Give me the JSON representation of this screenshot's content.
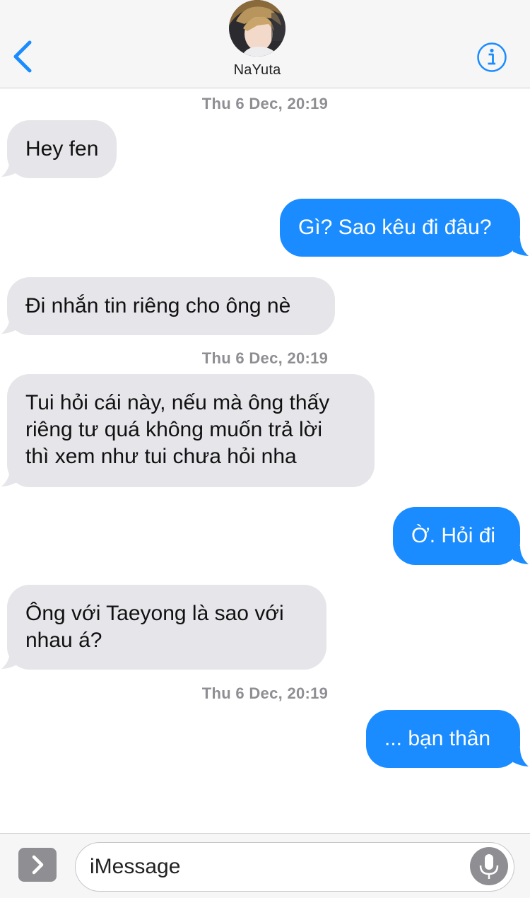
{
  "header": {
    "contact_name": "NaYuta",
    "back_icon": "chevron-left-icon",
    "info_icon": "info-circle-icon",
    "accent_color": "#1a8cff"
  },
  "conversation": {
    "timestamps": [
      "Thu 6 Dec, 20:19",
      "Thu 6 Dec, 20:19",
      "Thu 6 Dec, 20:19"
    ],
    "messages": [
      {
        "sender": "contact",
        "text": "Hey fen"
      },
      {
        "sender": "me",
        "text": "Gì? Sao kêu đi đâu?"
      },
      {
        "sender": "contact",
        "text": "Đi nhắn tin riêng cho ông nè"
      },
      {
        "sender": "contact",
        "lines": [
          "Tui hỏi cái này, nếu mà ông thấy",
          "riêng tư quá không muốn trả lời",
          "thì xem như tui chưa hỏi nha"
        ]
      },
      {
        "sender": "me",
        "text": "Ờ. Hỏi đi"
      },
      {
        "sender": "contact",
        "lines": [
          "Ông với Taeyong là sao với",
          "nhau á?"
        ]
      },
      {
        "sender": "me",
        "text": "... bạn thân"
      }
    ],
    "incoming_bubble_color": "#e5e5ea",
    "outgoing_bubble_color": "#1a8cff"
  },
  "compose": {
    "placeholder": "iMessage",
    "apps_icon": "chevron-right-icon",
    "mic_icon": "microphone-icon"
  }
}
